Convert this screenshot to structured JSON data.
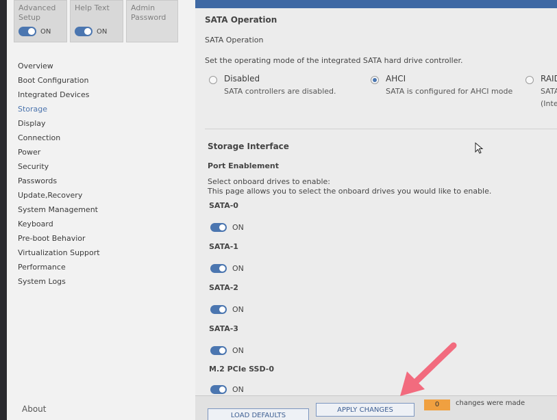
{
  "tiles": [
    {
      "label": "Advanced Setup",
      "toggle": "ON"
    },
    {
      "label": "Help Text",
      "toggle": "ON"
    },
    {
      "label": "Admin Password"
    }
  ],
  "nav": [
    "Overview",
    "Boot Configuration",
    "Integrated Devices",
    "Storage",
    "Display",
    "Connection",
    "Power",
    "Security",
    "Passwords",
    "Update,Recovery",
    "System Management",
    "Keyboard",
    "Pre-boot Behavior",
    "Virtualization Support",
    "Performance",
    "System Logs"
  ],
  "about": "About",
  "sata": {
    "section_title": "SATA Operation",
    "subtitle": "SATA Operation",
    "description": "Set the operating mode of the integrated SATA hard drive controller.",
    "options": [
      {
        "label": "Disabled",
        "desc": "SATA controllers are disabled.",
        "desc2": "",
        "selected": false
      },
      {
        "label": "AHCI",
        "desc": "SATA is configured for AHCI mode",
        "desc2": "",
        "selected": true
      },
      {
        "label": "RAID",
        "desc": "SATA",
        "desc2": "(Intel",
        "selected": false
      }
    ]
  },
  "storage": {
    "title": "Storage Interface",
    "port_title": "Port Enablement",
    "desc1": "Select onboard drives to enable:",
    "desc2": "This page allows you to select the onboard drives you would like to enable.",
    "drives": [
      {
        "name": "SATA-0",
        "state": "ON"
      },
      {
        "name": "SATA-1",
        "state": "ON"
      },
      {
        "name": "SATA-2",
        "state": "ON"
      },
      {
        "name": "SATA-3",
        "state": "ON"
      },
      {
        "name": "M.2 PCIe SSD-0",
        "state": "ON"
      }
    ]
  },
  "footer": {
    "load_defaults": "LOAD DEFAULTS",
    "apply_changes": "APPLY CHANGES",
    "changes_count": "0",
    "changes_text": "changes were made"
  },
  "colors": {
    "accent": "#4b76b0",
    "topbar": "#3f69a4",
    "count_badge": "#f0a040",
    "annotation_arrow": "#f26b7e"
  }
}
